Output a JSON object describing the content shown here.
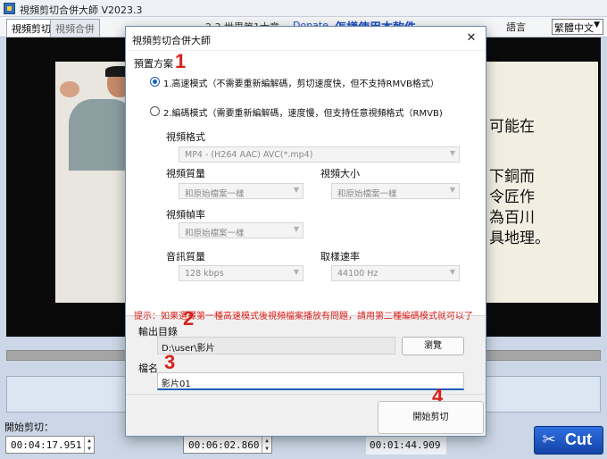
{
  "app": {
    "title": "視頻剪切合併大師 V2023.3",
    "tabs": [
      {
        "label": "視頻剪切"
      },
      {
        "label": "視頻合併"
      }
    ],
    "toolbar_extra": {
      "cut_marker": "2.3 世界第1大章",
      "donate": "Donate",
      "howto": "怎樣使用本軟件",
      "language_label": "語言",
      "language_value": "繁體中文"
    },
    "start_cut_label": "開始剪切：",
    "start_time": "00:04:17.951",
    "end_time": "00:06:02.860",
    "duration": "00:01:44.909",
    "cut_button_label": "Cut",
    "board_lines": [
      "可能在",
      "下銅而",
      "令匠作",
      "為百川",
      "具地理。"
    ],
    "colors": {
      "accent": "#1a5fb8",
      "hint": "#d9211b",
      "cut_button": "#1f55c4"
    }
  },
  "dialog": {
    "title": "視頻剪切合併大師",
    "close_icon": "close-icon",
    "preset_label": "預置方案",
    "option_fast": "1.高速模式（不需要重新編解碼，剪切速度快，但不支持RMVB格式）",
    "option_encode": "2.編碼模式（需要重新編解碼，速度慢，但支持任意視頻格式（RMVB)",
    "selected_option": "fast",
    "video_format_label": "視頻格式",
    "video_format_value": "MP4 - (H264 AAC) AVC(*.mp4)",
    "video_quality_label": "視頻質量",
    "video_quality_value": "和原始檔案一樣",
    "video_size_label": "視頻大小",
    "video_size_value": "和原始檔案一樣",
    "frame_rate_label": "視頻幀率",
    "frame_rate_value": "和原始檔案一樣",
    "audio_quality_label": "音訊質量",
    "audio_quality_value": "128 kbps",
    "sample_rate_label": "取樣速率",
    "sample_rate_value": "44100 Hz",
    "hint": "提示：如果選擇第一種高速模式後視頻檔案播放有問題，請用第二種編碼模式就可以了",
    "output_dir_label": "輸出目錄",
    "output_dir_value": "D:\\user\\影片",
    "browse_label": "瀏覽",
    "filename_label": "檔名",
    "filename_value": "影片01",
    "start_button_label": "開始剪切",
    "step_numbers": [
      "1",
      "2",
      "3",
      "4"
    ]
  }
}
